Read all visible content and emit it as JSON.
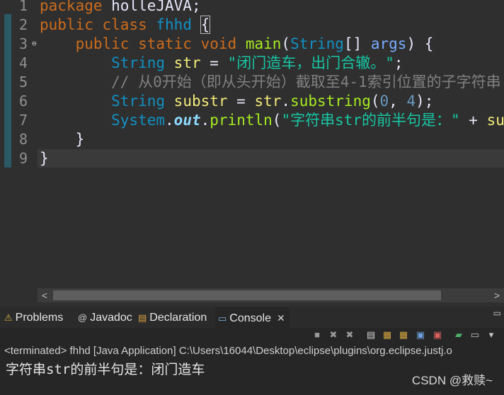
{
  "editor": {
    "lines": [
      {
        "n": "1",
        "t": [
          {
            "c": "kw",
            "v": "package"
          },
          {
            "c": "op",
            "v": " holleJAVA;"
          }
        ]
      },
      {
        "n": "2",
        "t": [
          {
            "c": "kw",
            "v": "public"
          },
          {
            "c": "op",
            "v": " "
          },
          {
            "c": "kw",
            "v": "class"
          },
          {
            "c": "op",
            "v": " "
          },
          {
            "c": "ty",
            "v": "fhhd"
          },
          {
            "c": "op",
            "v": " "
          },
          {
            "c": "op brace-box",
            "v": "{"
          }
        ]
      },
      {
        "n": "3",
        "fold": "⊖",
        "t": [
          {
            "c": "op",
            "v": "    "
          },
          {
            "c": "kw",
            "v": "public"
          },
          {
            "c": "op",
            "v": " "
          },
          {
            "c": "kw",
            "v": "static"
          },
          {
            "c": "op",
            "v": " "
          },
          {
            "c": "kw",
            "v": "void"
          },
          {
            "c": "op",
            "v": " "
          },
          {
            "c": "fn",
            "v": "main"
          },
          {
            "c": "op",
            "v": "("
          },
          {
            "c": "ty",
            "v": "String"
          },
          {
            "c": "op",
            "v": "[] "
          },
          {
            "c": "var",
            "v": "args"
          },
          {
            "c": "op",
            "v": ") {"
          }
        ]
      },
      {
        "n": "4",
        "t": [
          {
            "c": "op",
            "v": "        "
          },
          {
            "c": "ty",
            "v": "String"
          },
          {
            "c": "op",
            "v": " "
          },
          {
            "c": "id",
            "v": "str"
          },
          {
            "c": "op",
            "v": " = "
          },
          {
            "c": "str",
            "v": "\"闭门造车，出门合辙。\""
          },
          {
            "c": "op",
            "v": ";"
          }
        ]
      },
      {
        "n": "5",
        "t": [
          {
            "c": "op",
            "v": "        "
          },
          {
            "c": "cm",
            "v": "// 从0开始（即从头开始）截取至4-1索引位置的子字符串"
          }
        ]
      },
      {
        "n": "6",
        "t": [
          {
            "c": "op",
            "v": "        "
          },
          {
            "c": "ty",
            "v": "String"
          },
          {
            "c": "op",
            "v": " "
          },
          {
            "c": "id",
            "v": "substr"
          },
          {
            "c": "op",
            "v": " = "
          },
          {
            "c": "id",
            "v": "str"
          },
          {
            "c": "op",
            "v": "."
          },
          {
            "c": "fn",
            "v": "substring"
          },
          {
            "c": "op",
            "v": "("
          },
          {
            "c": "num",
            "v": "0"
          },
          {
            "c": "op",
            "v": ", "
          },
          {
            "c": "num",
            "v": "4"
          },
          {
            "c": "op",
            "v": ");"
          }
        ]
      },
      {
        "n": "7",
        "t": [
          {
            "c": "op",
            "v": "        "
          },
          {
            "c": "ty",
            "v": "System"
          },
          {
            "c": "op",
            "v": "."
          },
          {
            "c": "st",
            "v": "out"
          },
          {
            "c": "op",
            "v": "."
          },
          {
            "c": "fn",
            "v": "println"
          },
          {
            "c": "op",
            "v": "("
          },
          {
            "c": "str",
            "v": "\"字符串str的前半句是：\""
          },
          {
            "c": "op",
            "v": " + "
          },
          {
            "c": "id",
            "v": "su"
          }
        ]
      },
      {
        "n": "8",
        "t": [
          {
            "c": "op",
            "v": "    }"
          }
        ]
      },
      {
        "n": "9",
        "t": [
          {
            "c": "op",
            "v": "}"
          }
        ]
      }
    ]
  },
  "scrollbar": {
    "left_arrow": "<",
    "right_arrow": ">"
  },
  "panel": {
    "tabs": [
      {
        "label": "Problems",
        "icon": "problems-icon",
        "glyph": "⚠",
        "color": "#d9b344"
      },
      {
        "label": "Javadoc",
        "icon": "javadoc-icon",
        "glyph": "@",
        "color": "#cfcfcf"
      },
      {
        "label": "Declaration",
        "icon": "declaration-icon",
        "glyph": "▤",
        "color": "#d9a441"
      },
      {
        "label": "Console",
        "icon": "console-icon",
        "glyph": "▭",
        "color": "#7fb0e0",
        "active": true
      }
    ],
    "close_glyph": "✕",
    "menu_glyph": "▭",
    "status": "<terminated> fhhd [Java Application] C:\\Users\\16044\\Desktop\\eclipse\\plugins\\org.eclipse.justj.o",
    "output": "字符串str的前半句是：闭门造车"
  },
  "toolbar": [
    {
      "name": "terminate-icon",
      "glyph": "■",
      "color": "#9a9a9a"
    },
    {
      "name": "remove-launch-icon",
      "glyph": "✖",
      "color": "#9a9a9a"
    },
    {
      "name": "remove-all-terminated-icon",
      "glyph": "✖",
      "color": "#9a9a9a"
    },
    {
      "name": "clear-console-icon",
      "glyph": "▤",
      "color": "#d0d0d0"
    },
    {
      "name": "scroll-lock-icon",
      "glyph": "▦",
      "color": "#d4a640"
    },
    {
      "name": "word-wrap-icon",
      "glyph": "▦",
      "color": "#d4a640"
    },
    {
      "name": "show-on-stdout-icon",
      "glyph": "▣",
      "color": "#6fa0e0"
    },
    {
      "name": "show-on-stderr-icon",
      "glyph": "▣",
      "color": "#e06060"
    },
    {
      "name": "pin-console-icon",
      "glyph": "▰",
      "color": "#4fb06a"
    },
    {
      "name": "display-console-icon",
      "glyph": "▭",
      "color": "#c8c8c8"
    },
    {
      "name": "dropdown-icon",
      "glyph": "▾",
      "color": "#c8c8c8"
    }
  ],
  "watermark": "CSDN @救赎~"
}
